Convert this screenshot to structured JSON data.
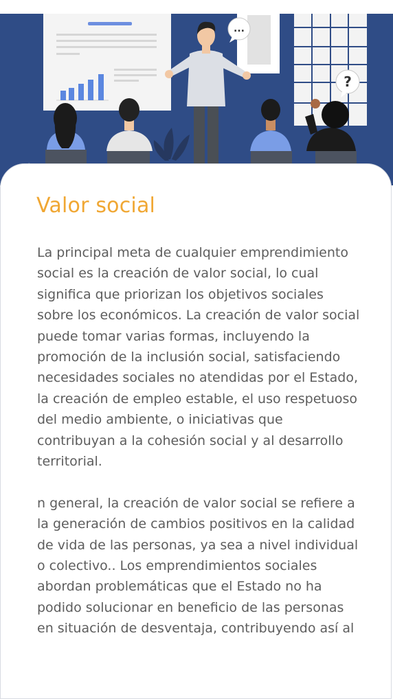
{
  "section": {
    "title": "Valor social",
    "paragraphs": [
      "La principal meta de cualquier emprendimiento social es la creación de valor social, lo cual significa que priorizan los objetivos sociales sobre los económicos. La creación de valor social puede tomar varias formas, incluyendo la promoción de la inclusión social, satisfaciendo necesidades sociales no atendidas por el Estado, la creación de empleo estable, el uso respetuoso del medio ambiente, o iniciativas que contribuyan a la cohesión social y al desarrollo territorial.",
      "n general, la creación de valor social se refiere a la generación de cambios positivos en la calidad de vida de las personas, ya sea a nivel individual o colectivo.. Los emprendimientos sociales abordan problemáticas que el Estado no ha podido solucionar en beneficio de las personas en situación de desventaja, contribuyendo así al"
    ]
  },
  "illustration": {
    "speech_bubble_text": "...",
    "question_bubble_text": "?",
    "colors": {
      "background": "#2f4c86",
      "accent_orange": "#f0a733",
      "bar_blue": "#5b87e0"
    }
  }
}
